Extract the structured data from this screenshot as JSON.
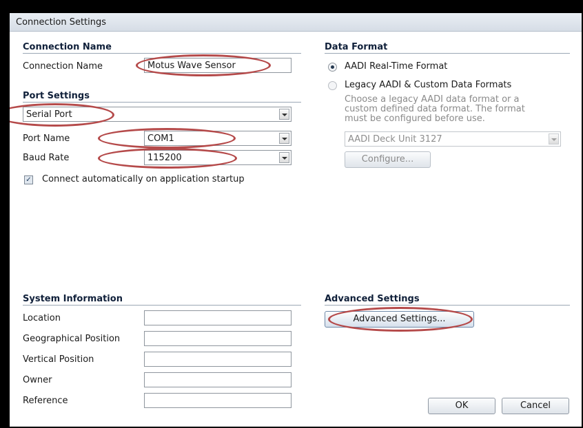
{
  "window": {
    "title": "Connection Settings"
  },
  "connection_name": {
    "section": "Connection Name",
    "label": "Connection Name",
    "value": "Motus Wave Sensor"
  },
  "port_settings": {
    "section": "Port Settings",
    "port_type": "Serial Port",
    "port_name_label": "Port Name",
    "port_name": "COM1",
    "baud_rate_label": "Baud Rate",
    "baud_rate": "115200",
    "auto_connect_label": "Connect automatically on application startup",
    "auto_connect_checked": true
  },
  "data_format": {
    "section": "Data Format",
    "option1": "AADI Real-Time Format",
    "option2": "Legacy AADI & Custom Data Formats",
    "desc_lines": [
      "Choose a legacy AADI data format or a",
      "custom defined data format. The format",
      "must be configured before use."
    ],
    "device": "AADI Deck Unit 3127",
    "configure_label": "Configure..."
  },
  "system_information": {
    "section": "System Information",
    "fields": [
      {
        "label": "Location",
        "value": ""
      },
      {
        "label": "Geographical Position",
        "value": ""
      },
      {
        "label": "Vertical Position",
        "value": ""
      },
      {
        "label": "Owner",
        "value": ""
      },
      {
        "label": "Reference",
        "value": ""
      }
    ]
  },
  "advanced": {
    "section": "Advanced Settings",
    "button_label": "Advanced Settings..."
  },
  "footer": {
    "ok_label": "OK",
    "cancel_label": "Cancel"
  },
  "colors": {
    "annotation": "#b54a4a",
    "background": "#000000",
    "section_rule": "#9aa6b4"
  },
  "icons": {
    "selected_radio": "radio-selected-icon",
    "checkbox": "checkbox-checked-icon",
    "dropdown": "chevron-down-icon"
  }
}
